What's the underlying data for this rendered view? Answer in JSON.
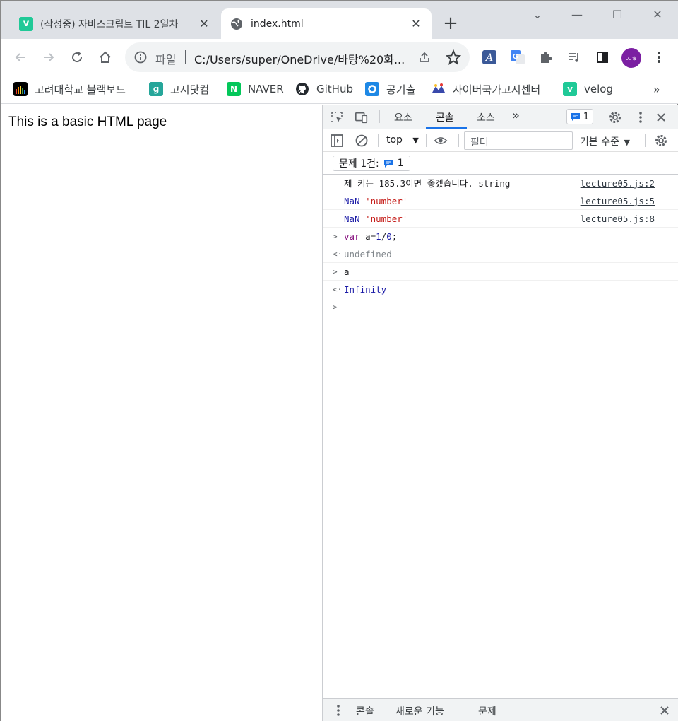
{
  "tabs": [
    {
      "title": "(작성중) 자바스크립트 TIL 2일차",
      "favicon": "velog-icon",
      "active": false
    },
    {
      "title": "index.html",
      "favicon": "globe-icon",
      "active": true
    }
  ],
  "toolbar": {
    "omnibox_label": "파일",
    "url": "C:/Users/super/OneDrive/바탕%20화..."
  },
  "bookmarks": [
    {
      "label": "고려대학교 블랙보드",
      "icon": "blackboard-icon"
    },
    {
      "label": "고시닷컴",
      "icon": "gosi-icon",
      "glyph": "g"
    },
    {
      "label": "NAVER",
      "icon": "naver-icon",
      "glyph": "N"
    },
    {
      "label": "GitHub",
      "icon": "github-icon"
    },
    {
      "label": "공기출",
      "icon": "gonggi-icon"
    },
    {
      "label": "사이버국가고시센터",
      "icon": "cyber-icon"
    },
    {
      "label": "velog",
      "icon": "velog-icon",
      "glyph": "v"
    }
  ],
  "bookmarks_more": "»",
  "avatar_text": "ㅅㅎ",
  "page": {
    "text": "This is a basic HTML page"
  },
  "devtools": {
    "tabs": [
      "요소",
      "콘솔",
      "소스"
    ],
    "active_tab": "콘솔",
    "more": "»",
    "issue_count": "1",
    "context": "top",
    "filter_placeholder": "필터",
    "level": "기본 수준",
    "issues_label": "문제 1건:",
    "issues_count": "1",
    "console": [
      {
        "prefix": "",
        "parts": [
          {
            "t": "제 키는 185.3이면 좋겠습니다. string",
            "c": ""
          }
        ],
        "source": "lecture05.js:2"
      },
      {
        "prefix": "",
        "parts": [
          {
            "t": "NaN ",
            "c": "c-nan"
          },
          {
            "t": "'number'",
            "c": "c-str"
          }
        ],
        "source": "lecture05.js:5"
      },
      {
        "prefix": "",
        "parts": [
          {
            "t": "NaN ",
            "c": "c-nan"
          },
          {
            "t": "'number'",
            "c": "c-str"
          }
        ],
        "source": "lecture05.js:8"
      },
      {
        "prefix": ">",
        "parts": [
          {
            "t": "var ",
            "c": "c-kw"
          },
          {
            "t": "a=",
            "c": ""
          },
          {
            "t": "1",
            "c": "c-num"
          },
          {
            "t": "/",
            "c": ""
          },
          {
            "t": "0",
            "c": "c-num"
          },
          {
            "t": ";",
            "c": ""
          }
        ],
        "source": ""
      },
      {
        "prefix": "<·",
        "parts": [
          {
            "t": "undefined",
            "c": "c-undef"
          }
        ],
        "source": ""
      },
      {
        "prefix": ">",
        "parts": [
          {
            "t": "a",
            "c": ""
          }
        ],
        "source": ""
      },
      {
        "prefix": "<·",
        "parts": [
          {
            "t": "Infinity",
            "c": "c-inf"
          }
        ],
        "source": ""
      }
    ],
    "drawer": [
      "콘솔",
      "새로운 기능",
      "문제"
    ]
  },
  "colors": {
    "accent": "#1a73e8",
    "avatar": "#7b1fa2",
    "velog": "#20c997",
    "naver": "#03c75a"
  }
}
